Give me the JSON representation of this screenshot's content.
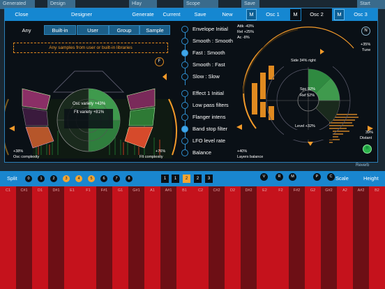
{
  "background_tabs": [
    "Generated",
    "Design",
    "Hlay",
    "Scope",
    "Save",
    "Start"
  ],
  "topbar": {
    "close": "Close",
    "title": "Designer",
    "generate": "Generate",
    "current": "Current",
    "save": "Save",
    "new": "New",
    "m1": "M",
    "osc1": "Osc 1",
    "m2": "M",
    "osc2": "Osc 2",
    "m3": "M",
    "osc3": "Osc 3"
  },
  "source_tabs": [
    "Any",
    "Built-in",
    "User",
    "Group",
    "Sample"
  ],
  "source_selected": "Any",
  "source_message": "Any samples from user or built-in libraries",
  "left_dial": {
    "f_button": "F",
    "osc_variety": "Osc variety +43%",
    "flt_variety": "Flt variety +81%",
    "osc_complexity_value": "+38%",
    "osc_complexity_label": "Osc complexity",
    "flt_complexity_value": "+76%",
    "flt_complexity_label": "Flt complexity"
  },
  "style_list": [
    {
      "label": "Envelope Initial",
      "selected": false
    },
    {
      "label": "Smooth : Smooth",
      "selected": false
    },
    {
      "label": "Fast : Smooth",
      "selected": true
    },
    {
      "label": "Smooth : Fast",
      "selected": false
    },
    {
      "label": "Slow : Slow",
      "selected": false
    }
  ],
  "effect_list": [
    {
      "label": "Effect 1 Initial",
      "selected": false
    },
    {
      "label": "Low pass filters",
      "selected": false
    },
    {
      "label": "Flanger intens",
      "selected": false
    },
    {
      "label": "Band stop filter",
      "selected": true
    },
    {
      "label": "LFO level rate",
      "selected": false
    },
    {
      "label": "Balance",
      "selected": false
    }
  ],
  "layers_balance_value": "+40%",
  "layers_balance_label": "Layers balance",
  "right_dial": {
    "atk": "Attk -43%",
    "rel": "Rel +25%",
    "ac": "Ac -8%",
    "n_button": "N",
    "tune_value": "+35%",
    "tune_label": "Tune",
    "side": "Side 34% right",
    "spc": "Spc 92%",
    "ref": "Ref 52%",
    "level": "Level +32%",
    "distant_value": "39%",
    "distant_label": "Distant",
    "r_button": "R"
  },
  "background_label": "Reverb",
  "splitbar": {
    "split": "Split",
    "notes": [
      "0",
      "1",
      "2",
      "3",
      "4",
      "5",
      "6",
      "7",
      "8"
    ],
    "highlight_notes": [
      "3",
      "4",
      "5"
    ],
    "octaves": [
      "1",
      "1",
      "2",
      "2",
      "3"
    ],
    "octave_highlight": 2,
    "mods": [
      "V",
      "R",
      "M",
      "P",
      "C"
    ],
    "scale": "Scale",
    "height": "Height"
  },
  "keys": [
    "C1",
    "C#1",
    "D1",
    "D#1",
    "E1",
    "F1",
    "F#1",
    "G1",
    "G#1",
    "A1",
    "A#1",
    "B1",
    "C2",
    "C#2",
    "D2",
    "D#2",
    "E2",
    "F2",
    "F#2",
    "G2",
    "G#2",
    "A2",
    "A#2",
    "B2"
  ],
  "colors": {
    "accent_blue": "#1587d1",
    "accent_orange": "#f39a2a",
    "accent_green": "#2f9a55",
    "key_light": "#c5121c",
    "key_dark": "#6d0f15"
  }
}
